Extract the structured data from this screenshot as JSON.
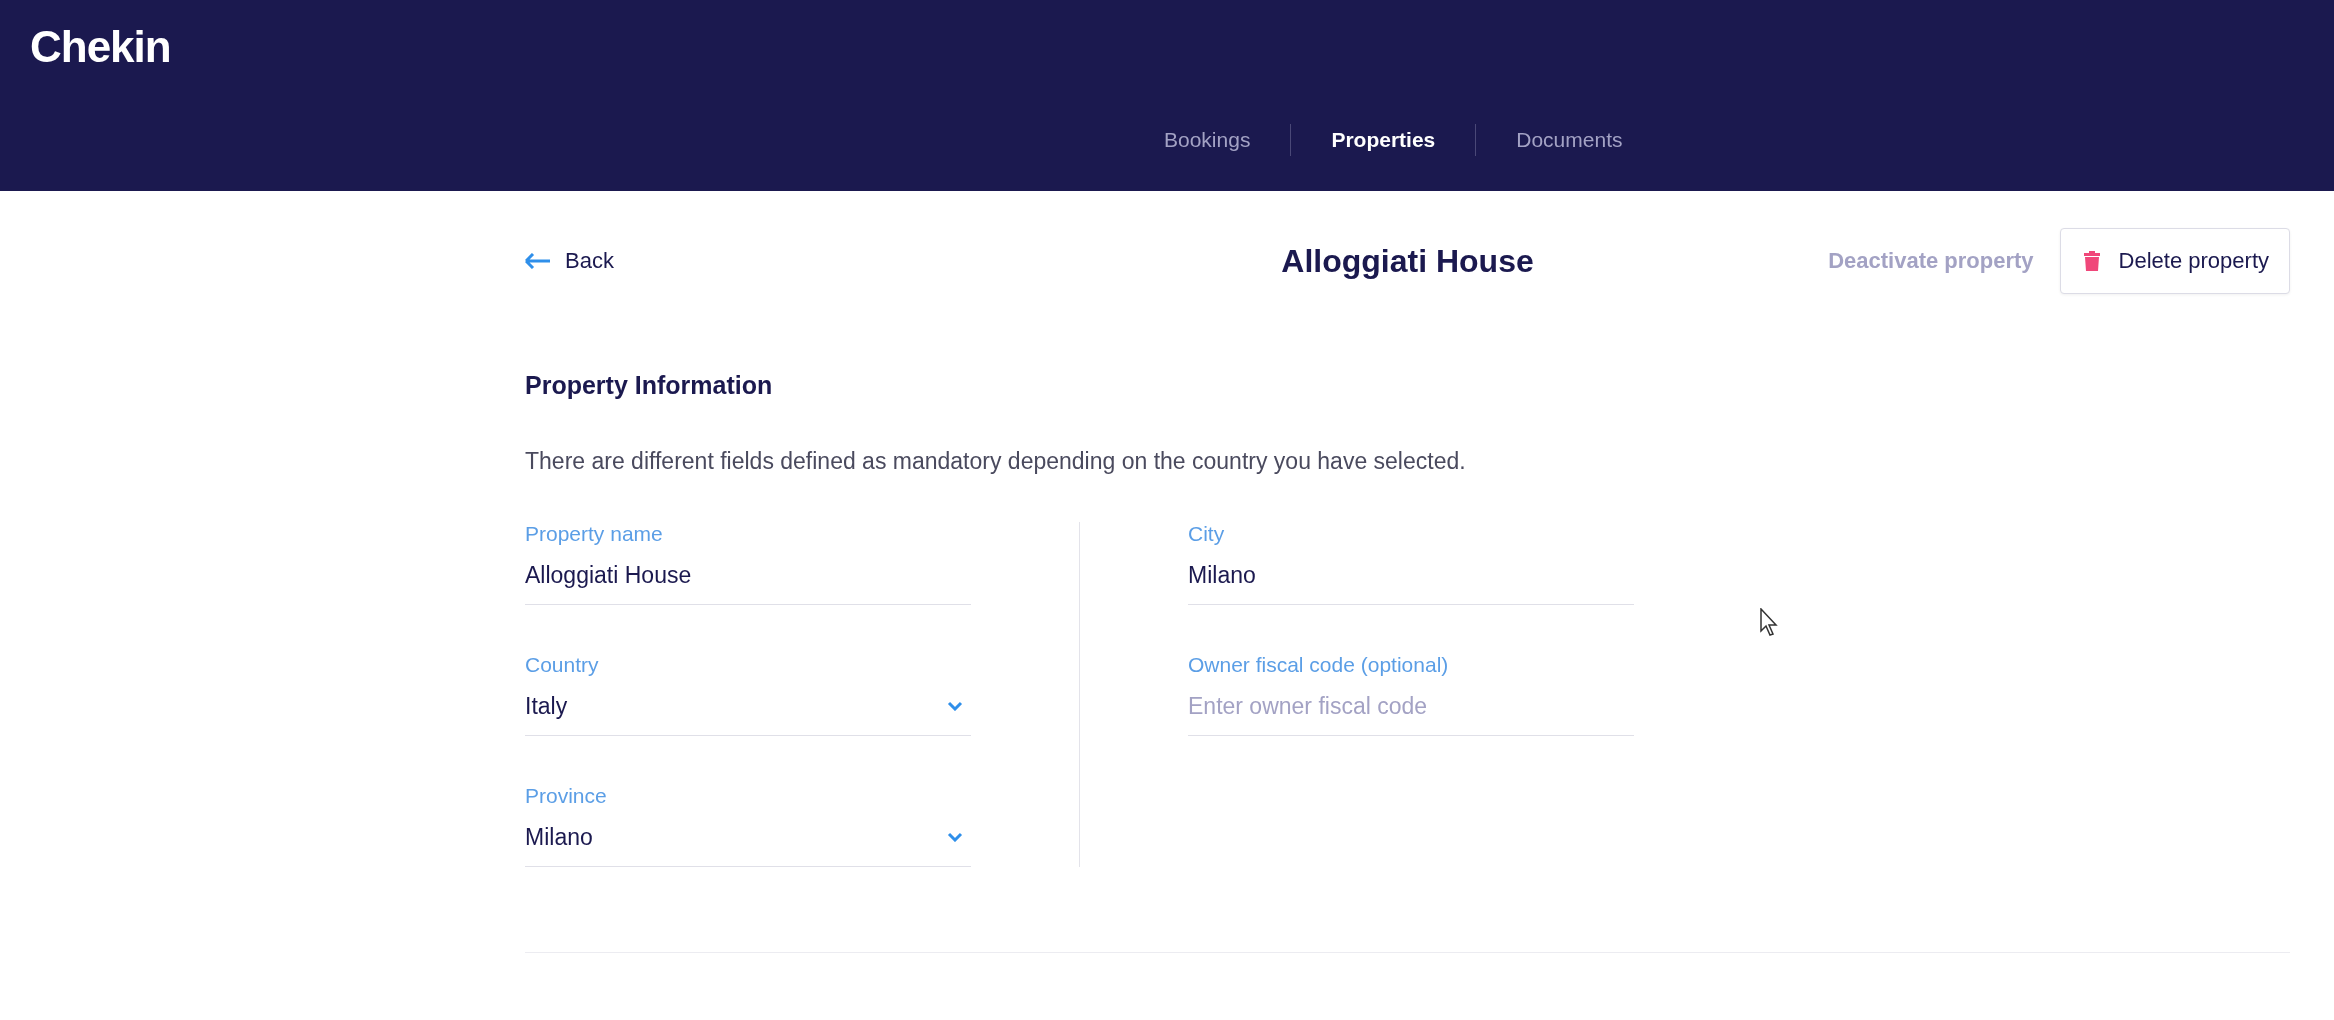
{
  "header": {
    "logo": "Chekin",
    "nav": [
      {
        "label": "Bookings",
        "selected": false
      },
      {
        "label": "Properties",
        "selected": true
      },
      {
        "label": "Documents",
        "selected": false
      }
    ]
  },
  "toolbar": {
    "back": "Back",
    "title": "Alloggiati House",
    "deactivate": "Deactivate property",
    "delete": "Delete property"
  },
  "section": {
    "title": "Property Information",
    "description": "There are different fields defined as mandatory depending on the country you have selected.",
    "columns": [
      [
        {
          "kind": "text",
          "label": "Property name",
          "value": "Alloggiati House"
        },
        {
          "kind": "select",
          "label": "Country",
          "value": "Italy"
        },
        {
          "kind": "select",
          "label": "Province",
          "value": "Milano"
        }
      ],
      [
        {
          "kind": "text",
          "label": "City",
          "value": "Milano"
        },
        {
          "kind": "text",
          "label": "Owner fiscal code (optional)",
          "placeholder": "Enter owner fiscal code"
        }
      ]
    ]
  }
}
